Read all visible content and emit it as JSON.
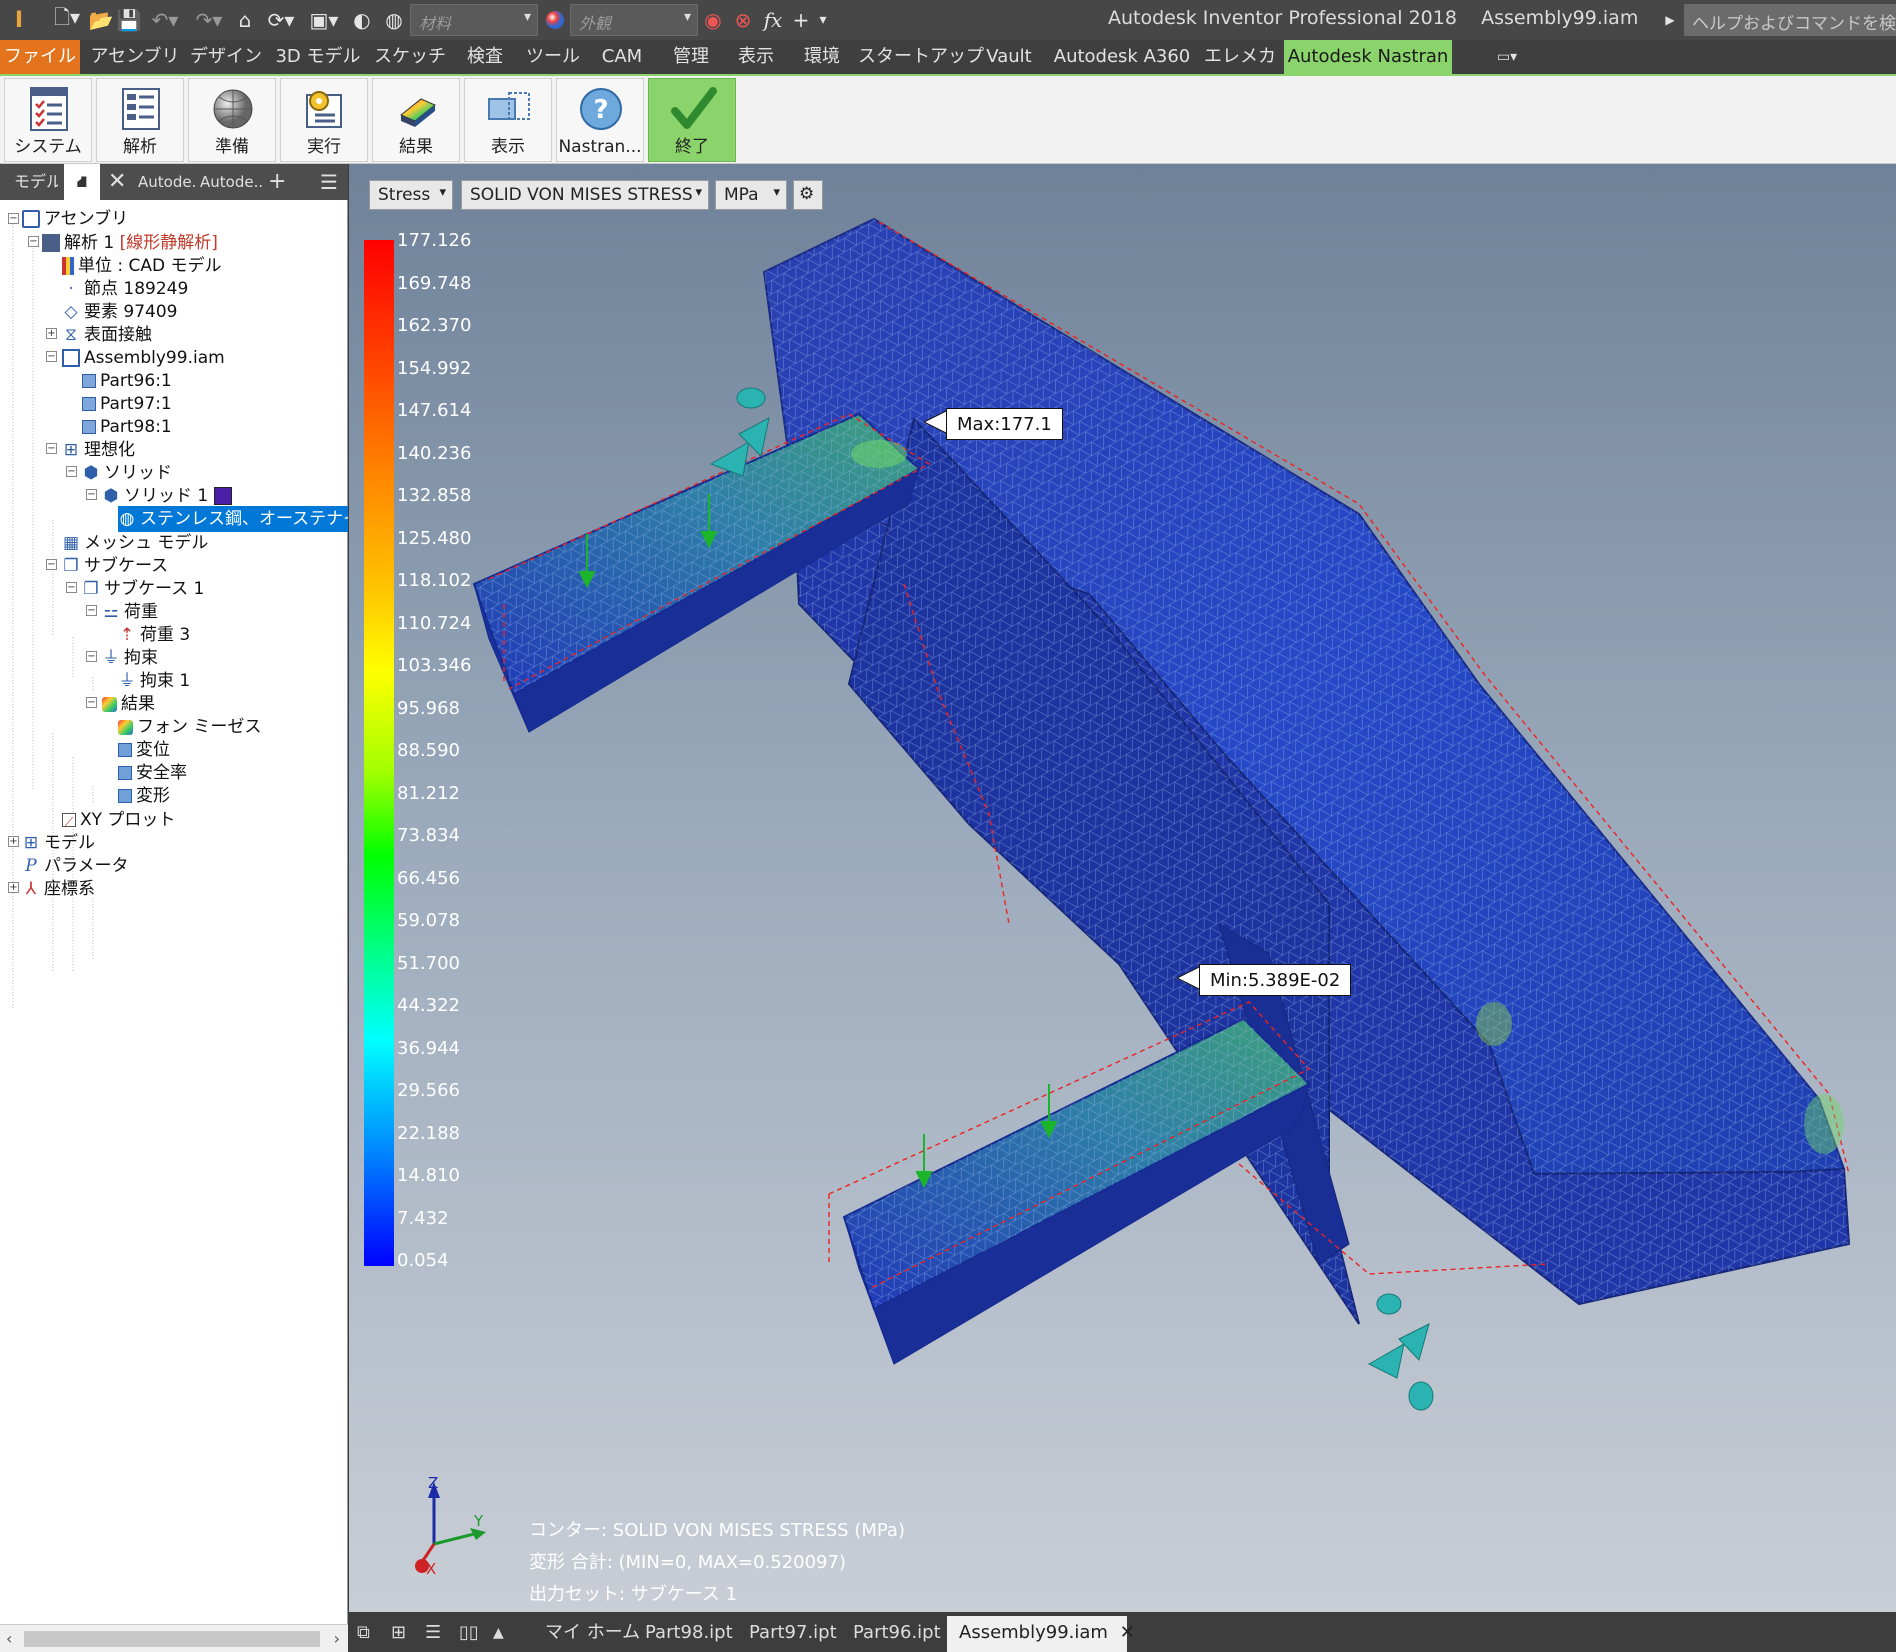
{
  "app": {
    "title": "Autodesk Inventor Professional 2018",
    "document": "Assembly99.iam",
    "material_placeholder": "材料",
    "appearance_placeholder": "外観",
    "help_search": "ヘルプおよびコマンドを検索..."
  },
  "menu": {
    "file": "ファイル",
    "items": [
      "アセンブリ",
      "デザイン",
      "3D モデル",
      "スケッチ",
      "検査",
      "ツール",
      "CAM",
      "管理",
      "表示",
      "環境",
      "スタートアップ",
      "Vault",
      "Autodesk A360",
      "エレメカ"
    ],
    "active": "Autodesk Nastran"
  },
  "ribbon": {
    "buttons": [
      "システム",
      "解析",
      "準備",
      "実行",
      "結果",
      "表示",
      "Nastran...",
      "終了"
    ]
  },
  "panel": {
    "tab_model": "モデル",
    "tab_a": "Autode...",
    "tab_b": "Autode...",
    "add": "+",
    "tree": [
      "アセンブリ",
      "解析 1",
      "[線形静解析]",
      "単位 : CAD モデル",
      "節点 189249",
      "要素 97409",
      "表面接触",
      "Assembly99.iam",
      "Part96:1",
      "Part97:1",
      "Part98:1",
      "理想化",
      "ソリッド",
      "ソリッド 1",
      "ステンレス鋼、オーステナイト系",
      "メッシュ モデル",
      "サブケース",
      "サブケース 1",
      "荷重",
      "荷重 3",
      "拘束",
      "拘束 1",
      "結果",
      "フォン ミーゼス",
      "変位",
      "安全率",
      "変形",
      "XY プロット",
      "モデル",
      "パラメータ",
      "座標系"
    ]
  },
  "viewport": {
    "result_type": "Stress",
    "component": "SOLID VON MISES STRESS",
    "unit": "MPa",
    "legend_values": [
      "177.126",
      "169.748",
      "162.370",
      "154.992",
      "147.614",
      "140.236",
      "132.858",
      "125.480",
      "118.102",
      "110.724",
      "103.346",
      "95.968",
      "88.590",
      "81.212",
      "73.834",
      "66.456",
      "59.078",
      "51.700",
      "44.322",
      "36.944",
      "29.566",
      "22.188",
      "14.810",
      "7.432",
      "0.054"
    ],
    "max_label": "Max:177.1",
    "min_label": "Min:5.389E-02",
    "info": [
      "コンター: SOLID VON MISES STRESS (MPa)",
      "変形 合計: (MIN=0, MAX=0.520097)",
      "出力セット: サブケース 1"
    ],
    "axes": {
      "z": "Z",
      "y": "Y",
      "x": "X"
    }
  },
  "bottom_tabs": [
    "マイ ホーム",
    "Part98.ipt",
    "Part97.ipt",
    "Part96.ipt",
    "Assembly99.iam"
  ],
  "colors": {
    "accent": "#8bd46b",
    "file_menu": "#e3741d",
    "selection": "#0078d7"
  }
}
